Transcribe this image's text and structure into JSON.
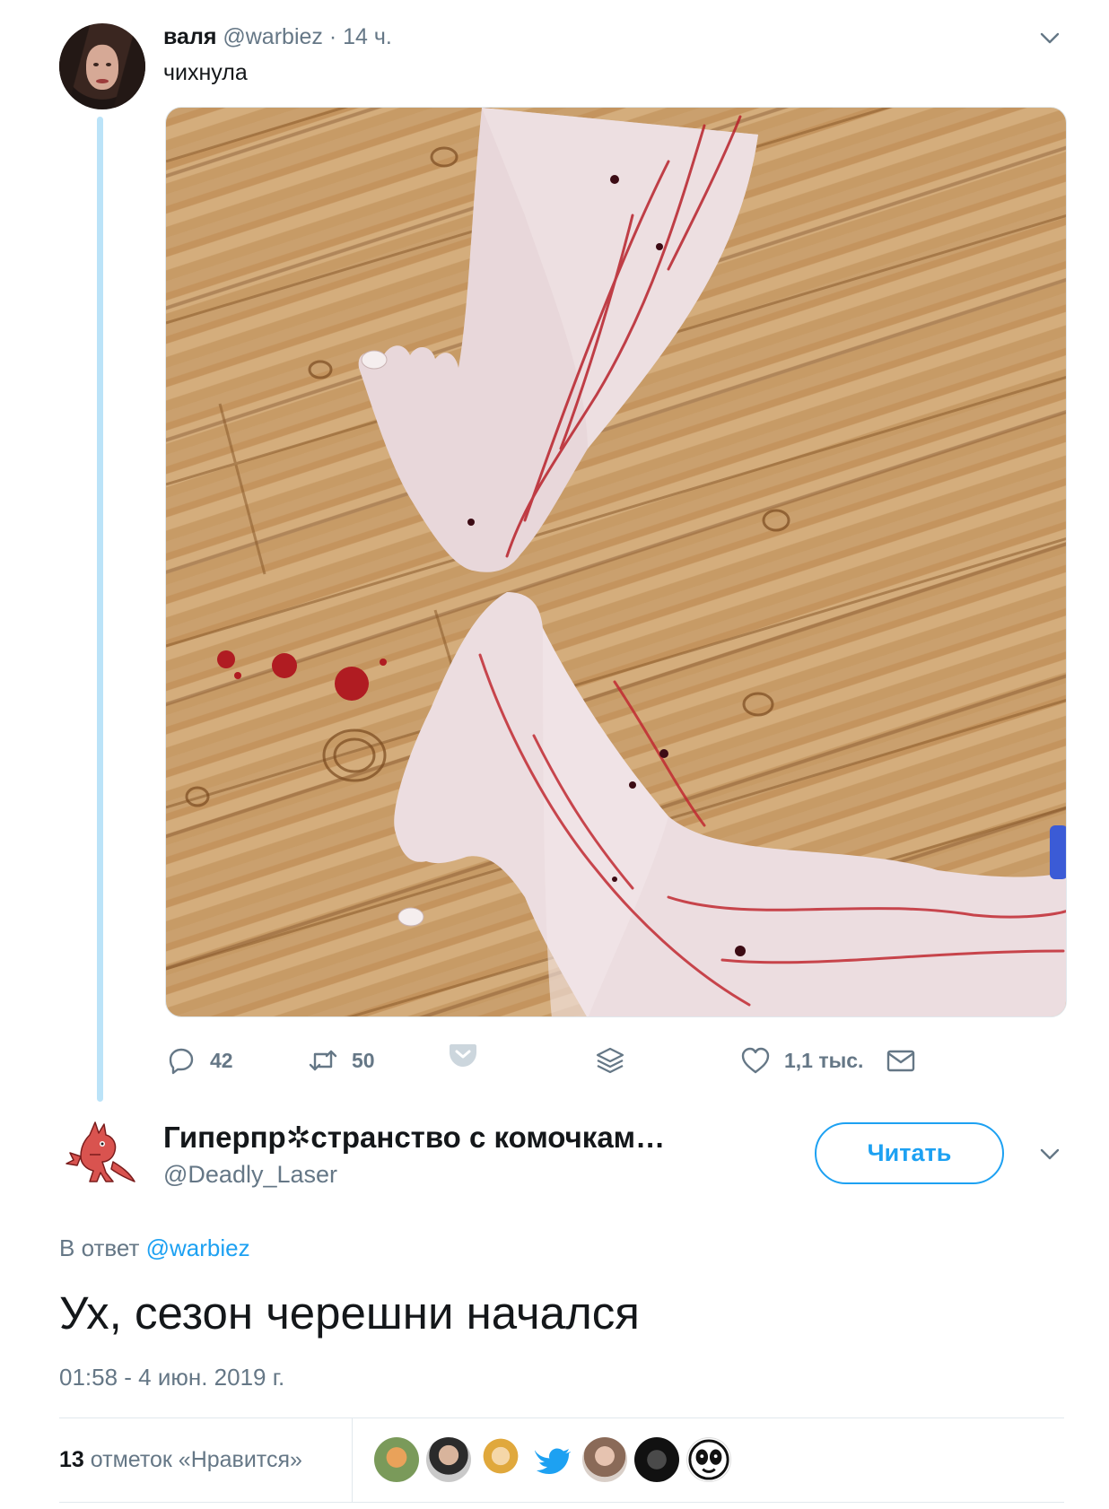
{
  "tweet": {
    "author_name": "валя",
    "author_handle": "@warbiez",
    "time_ago": "· 14 ч.",
    "text": "чихнула",
    "actions": {
      "reply_count": "42",
      "retweet_count": "50",
      "like_count": "1,1 тыс."
    }
  },
  "reply": {
    "author_name": "Гиперпр✲странство с комочкам…",
    "author_handle": "@Deadly_Laser",
    "follow_label": "Читать",
    "reply_prefix": "В ответ",
    "reply_to": "@warbiez",
    "text": "Ух, сезон черешни начался",
    "timestamp": "01:58 - 4 июн. 2019 г.",
    "likes_count": "13",
    "likes_label": "отметок «Нравится»"
  },
  "colors": {
    "accent": "#1da1f2",
    "muted": "#657786",
    "thread_line": "#bbe3f8"
  },
  "icons": [
    "chevron-down-icon",
    "reply-icon",
    "retweet-icon",
    "pocket-icon",
    "layers-icon",
    "heart-icon",
    "mail-icon"
  ]
}
